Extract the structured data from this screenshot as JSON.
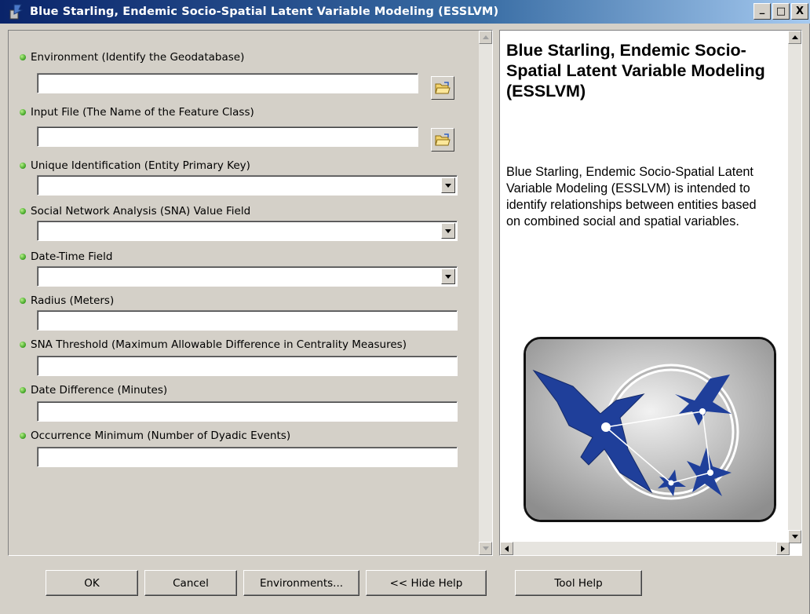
{
  "window": {
    "title": "Blue Starling, Endemic Socio-Spatial Latent Variable Modeling (ESSLVM)",
    "title_buttons": [
      "_",
      "□",
      "X"
    ]
  },
  "params": [
    {
      "label": "Environment (Identify the Geodatabase)",
      "type": "text-browse",
      "value": ""
    },
    {
      "label": "Input File (The Name of the Feature Class)",
      "type": "text-browse",
      "value": ""
    },
    {
      "label": "Unique Identification (Entity Primary Key)",
      "type": "combo",
      "value": ""
    },
    {
      "label": "Social Network Analysis (SNA) Value Field",
      "type": "combo",
      "value": ""
    },
    {
      "label": "Date-Time Field",
      "type": "combo",
      "value": ""
    },
    {
      "label": "Radius (Meters)",
      "type": "text",
      "value": ""
    },
    {
      "label": "SNA Threshold (Maximum Allowable Difference in Centrality Measures)",
      "type": "text",
      "value": ""
    },
    {
      "label": "Date Difference (Minutes)",
      "type": "text",
      "value": ""
    },
    {
      "label": "Occurrence Minimum (Number of Dyadic Events)",
      "type": "text",
      "value": ""
    }
  ],
  "help": {
    "title": "Blue Starling, Endemic Socio-Spatial Latent Variable Modeling (ESSLVM)",
    "body": "Blue Starling, Endemic Socio-Spatial Latent Variable Modeling (ESSLVM) is intended to identify relationships between entities based on combined social and spatial variables."
  },
  "buttons": {
    "ok": "OK",
    "cancel": "Cancel",
    "environments": "Environments...",
    "hide_help": "<< Hide Help",
    "tool_help": "Tool Help"
  },
  "colors": {
    "title_gradient_start": "#0a246a",
    "title_gradient_end": "#a6caf0",
    "dialog_bg": "#d4d0c8",
    "required_dot": "#3aa020",
    "bird_blue": "#1f3f9a"
  }
}
